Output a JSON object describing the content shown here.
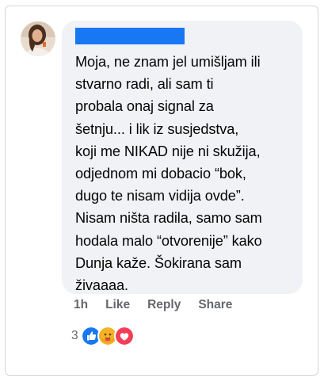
{
  "comment": {
    "author_name_redacted": true,
    "text": "Moja, ne znam jel umišljam ili\nstvarno radi, ali sam ti\nprobala onaj signal za\nšetnju... i lik iz susjedstva,\nkoji me NIKAD nije ni skužija,\nodjednom mi dobacio “bok,\ndugo te nisam vidija ovde”.\nNisam ništa radila, samo sam\nhodala malo “otvorenije” kako\nDunja kaže. Šokirana sam\nživaaaa."
  },
  "actions": {
    "time": "1h",
    "like": "Like",
    "reply": "Reply",
    "share": "Share"
  },
  "reactions": {
    "count": "3",
    "icons": [
      "like-icon",
      "care-icon",
      "love-icon"
    ]
  },
  "colors": {
    "bubble": "#f0f2f5",
    "redaction": "#1877f2",
    "like": "#1877f2",
    "love": "#f33e58",
    "care": "#f7b125"
  }
}
